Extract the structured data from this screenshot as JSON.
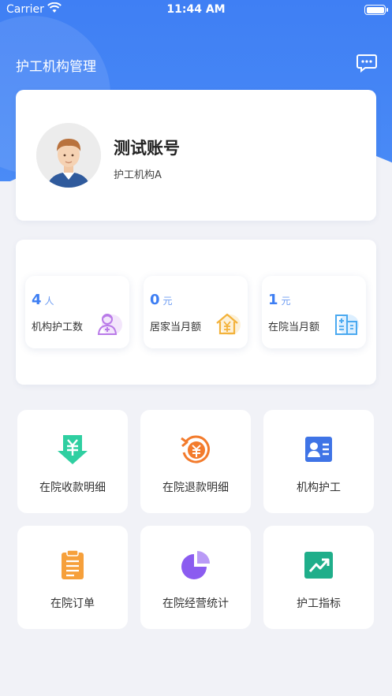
{
  "status_bar": {
    "carrier": "Carrier",
    "time": "11:44 AM"
  },
  "header": {
    "title": "护工机构管理",
    "message_icon": "chat-bubble-icon"
  },
  "profile": {
    "account_name": "测试账号",
    "organization": "护工机构A",
    "avatar_icon": "user-avatar-icon"
  },
  "stats": [
    {
      "value": "4",
      "unit": "人",
      "label": "机构护工数",
      "icon": "caregiver-icon",
      "icon_color": "#b97ae8"
    },
    {
      "value": "0",
      "unit": "元",
      "label": "居家当月额",
      "icon": "home-yuan-icon",
      "icon_color": "#f3b23a"
    },
    {
      "value": "1",
      "unit": "元",
      "label": "在院当月额",
      "icon": "hospital-icon",
      "icon_color": "#4aa9f0"
    }
  ],
  "menu": [
    {
      "label": "在院收款明细",
      "icon": "receive-payment-icon",
      "color": "#2fcfa1"
    },
    {
      "label": "在院退款明细",
      "icon": "refund-icon",
      "color": "#f37b2c"
    },
    {
      "label": "机构护工",
      "icon": "caregiver-card-icon",
      "color": "#3f74e6"
    },
    {
      "label": "在院订单",
      "icon": "clipboard-icon",
      "color": "#f6a03b"
    },
    {
      "label": "在院经营统计",
      "icon": "pie-chart-icon",
      "color": "#8b5cf0"
    },
    {
      "label": "护工指标",
      "icon": "trend-up-icon",
      "color": "#1fae8a"
    }
  ]
}
